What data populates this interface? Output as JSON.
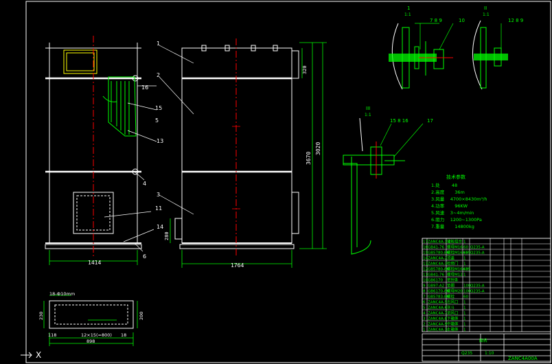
{
  "dimensions": {
    "left_width": "1414",
    "right_width": "1764",
    "height_outer": "3020",
    "height_inner": "3670",
    "flange_h": "320",
    "nozzle_h": "280",
    "detail_width_outer": "898",
    "detail_width_mid": "12×15(=800)",
    "detail_left": "118",
    "detail_right": "18",
    "detail_top_h": "230",
    "detail_inner_h": "200",
    "detail_label": "18-Ф10mm"
  },
  "callouts": {
    "n1": "1",
    "n2": "2",
    "n3": "3",
    "n4": "4",
    "n5": "5",
    "n6": "6",
    "n10": "10",
    "n11": "11",
    "n12": "12",
    "n13": "13",
    "n14": "14",
    "n15": "15",
    "n16": "16",
    "n17": "17",
    "c789": "7 8 9",
    "c12_8_9": "12 8 9",
    "c15_8_16": "15 8 16"
  },
  "section_marks": {
    "s1_top": "1",
    "s1_bot": "1:1",
    "s2_top": "II",
    "s2_bot": "1:1",
    "s3_top": "III",
    "s3_bot": "1:1"
  },
  "specs": {
    "heading": "技术参数",
    "lines": [
      "1.处  　　 48",
      "2.高度　　 36m",
      "3.风量　 4700×8430m³/h",
      "4.功率　　 96KW",
      "5.风速　 3~4m/min",
      "6.阻力　 1200~1300Pa",
      "7.重量　　 14800kg"
    ]
  },
  "title_block": {
    "drawing_no": "ZANC4A00A",
    "scale": "1:10",
    "material": "Q235",
    "name": "图名"
  },
  "bom_rows": [
    [
      "17",
      "ZANC4A-1-1",
      "管板组合",
      "1",
      "",
      "",
      "",
      ""
    ],
    [
      "16",
      "GB41-76",
      "螺母M16",
      "60",
      "Q235-A",
      "",
      "",
      ""
    ],
    [
      "15",
      "GB5780-86",
      "螺栓M16×55",
      "60",
      "Q235-A",
      "",
      "",
      ""
    ],
    [
      "14",
      "ZANC4A-2",
      "顶盖",
      "1",
      "",
      "",
      "",
      ""
    ],
    [
      "13",
      "ZANC4A-3",
      "检修门",
      "1",
      "",
      "",
      "",
      ""
    ],
    [
      "12",
      "GB5780-86",
      "螺栓M16×35",
      "60",
      "",
      "",
      "",
      ""
    ],
    [
      "11",
      "GB41-76",
      "螺母M12",
      "1",
      "",
      "",
      "",
      ""
    ],
    [
      "10",
      "GB6170",
      "密封条",
      ".",
      "",
      "",
      "",
      ""
    ],
    [
      "9",
      "GB97-A2",
      "垫圈",
      "100",
      "Q235-A",
      "",
      "",
      ""
    ],
    [
      "8",
      "GB6170-86",
      "螺母M20",
      "100",
      "Q235-A",
      "",
      "",
      ""
    ],
    [
      "7",
      "GB5783-86",
      "螺栓",
      "60",
      "",
      "",
      "",
      ""
    ],
    [
      "6",
      "ZANC4A-5",
      "出风口",
      "1",
      "",
      "",
      "",
      ""
    ],
    [
      "5",
      "ZANC4A-6",
      "灰斗",
      "1",
      "",
      "",
      "",
      ""
    ],
    [
      "4",
      "ZANC4A-7",
      "进风口",
      "1",
      "",
      "",
      "",
      ""
    ],
    [
      "3",
      "ZANC4A-8",
      "下箱体",
      "1",
      "",
      "",
      "",
      ""
    ],
    [
      "2",
      "ZANC4A-9",
      "中箱体",
      "1",
      "",
      "",
      "",
      ""
    ],
    [
      "1",
      "ZANC4A-10",
      "上箱体",
      "1",
      "",
      "",
      "",
      ""
    ]
  ],
  "coordinate_axis": "X",
  "colors": {
    "outline": "#ffffff",
    "dimension": "#00ff00",
    "centerline": "#ff0000",
    "detail": "#00ff00",
    "background": "#000000"
  }
}
